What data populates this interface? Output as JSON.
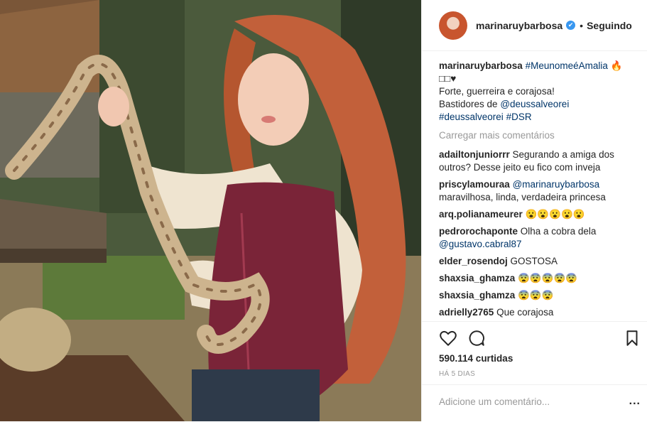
{
  "header": {
    "username": "marinaruybarbosa",
    "verified_mark": "✔",
    "separator": "•",
    "follow_status": "Seguindo"
  },
  "caption": {
    "username": "marinaruybarbosa",
    "hashtag1": "#MeunomeéAmalia",
    "emoji": "🔥",
    "line2": "□□♥",
    "line3": "Forte, guerreira e corajosa!",
    "line4_prefix": "Bastidores de ",
    "mention": "@deussalveorei",
    "tag2": "#deussalveorei",
    "tag3": "#DSR"
  },
  "load_more": "Carregar mais comentários",
  "comments": [
    {
      "user": "adailtonjuniorrr",
      "text": "Segurando a amiga dos outros? Desse jeito eu fico com inveja",
      "mention": ""
    },
    {
      "user": "priscylamouraa",
      "text": "maravilhosa, linda, verdadeira princesa",
      "mention": "@marinaruybarbosa"
    },
    {
      "user": "arq.polianameurer",
      "text": "😮😮😮😮😮",
      "mention": ""
    },
    {
      "user": "pedrorochaponte",
      "text": "Olha a cobra dela",
      "mention": "@gustavo.cabral87"
    },
    {
      "user": "elder_rosendoj",
      "text": "GOSTOSA",
      "mention": ""
    },
    {
      "user": "shaxsia_ghamza",
      "text": "😨😨😨😨😨",
      "mention": ""
    },
    {
      "user": "shaxsia_ghamza",
      "text": "😨😨😨",
      "mention": ""
    },
    {
      "user": "adrielly2765",
      "text": "Que corajosa",
      "mention": ""
    }
  ],
  "actions": {
    "like_icon": "heart-icon",
    "comment_icon": "comment-icon",
    "save_icon": "bookmark-icon",
    "likes": "590.114 curtidas",
    "date": "HÁ 5 DIAS",
    "add_comment_placeholder": "Adicione um comentário...",
    "more_options": "..."
  },
  "colors": {
    "link": "#003569",
    "verified": "#3897f0",
    "muted": "#999999"
  }
}
